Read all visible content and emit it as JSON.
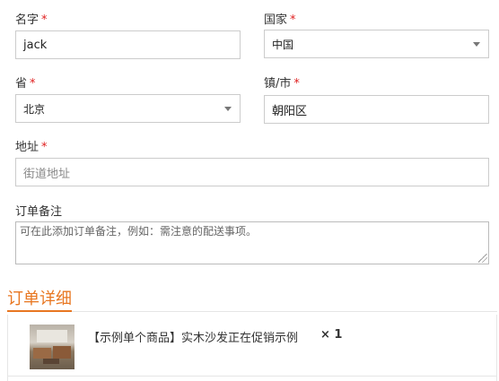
{
  "form": {
    "name": {
      "label": "名字",
      "required_mark": "*",
      "value": "jack"
    },
    "country": {
      "label": "国家",
      "required_mark": "*",
      "selected": "中国"
    },
    "province": {
      "label": "省",
      "required_mark": "*",
      "selected": "北京"
    },
    "town": {
      "label": "镇/市",
      "required_mark": "*",
      "value": "朝阳区"
    },
    "address": {
      "label": "地址",
      "required_mark": "*",
      "placeholder": "街道地址"
    },
    "notes": {
      "label": "订单备注",
      "placeholder": "可在此添加订单备注，例如：需注意的配送事项。"
    }
  },
  "order": {
    "section_title": "订单详细",
    "items": [
      {
        "name": "【示例单个商品】实木沙发正在促销示例",
        "quantity": "× 1",
        "thumbnail_icon": "sofa-product-image"
      }
    ]
  },
  "colors": {
    "accent": "#e87722",
    "required": "#e02020"
  }
}
